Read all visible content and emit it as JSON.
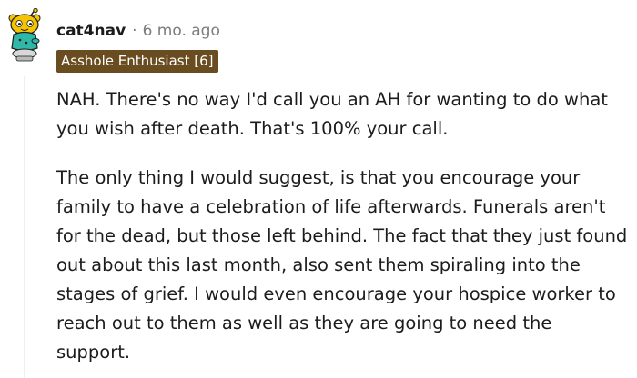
{
  "comment": {
    "author": "cat4nav",
    "separator": "·",
    "timestamp": "6 mo. ago",
    "flair": "Asshole Enthusiast [6]",
    "avatar_icon": "snoo-avatar-icon",
    "paragraphs": [
      "NAH. There's no way I'd call you an AH for wanting to do what you wish after death. That's 100% your call.",
      "The only thing I would suggest, is that you encourage your family to have a celebration of life afterwards. Funerals aren't for the dead, but those left behind. The fact that they just found out about this last month, also sent them spiraling into the stages of grief. I would even encourage your hospice worker to reach out to them as well as they are going to need the support."
    ]
  },
  "colors": {
    "flair_bg": "#6a4c21",
    "meta_text": "#7c7c7c",
    "body_text": "#1c1c1c",
    "thread_line": "#edeff1"
  }
}
